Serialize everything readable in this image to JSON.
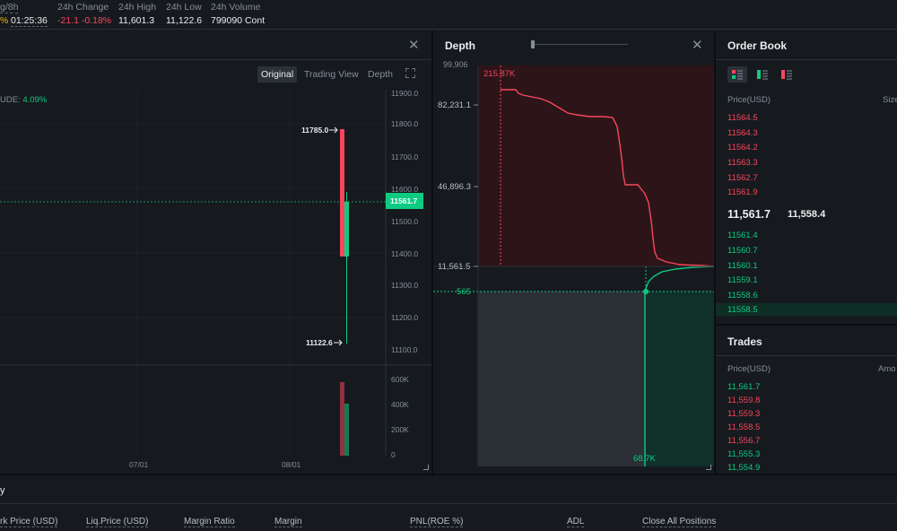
{
  "ticker": {
    "funding_label": "g/8h",
    "funding_pct": "%",
    "countdown": "01:25:36",
    "change_label": "24h Change",
    "change_value": "-21.1 -0.18%",
    "high_label": "24h High",
    "high_value": "11,601.3",
    "low_label": "24h Low",
    "low_value": "11,122.6",
    "volume_label": "24h Volume",
    "volume_value": "799090 Cont"
  },
  "chart": {
    "views": [
      "Original",
      "Trading View",
      "Depth"
    ],
    "active_view": "Original",
    "indicator": "UDE:",
    "indicator_value": "4.09%",
    "price_ticks": [
      "11900.0",
      "11800.0",
      "11700.0",
      "11600.0",
      "11500.0",
      "11400.0",
      "11300.0",
      "11200.0",
      "11100.0"
    ],
    "volume_ticks": [
      "600K",
      "400K",
      "200K",
      "0"
    ],
    "date_ticks": [
      "07/01",
      "08/01"
    ],
    "last_price_tag": "11561.7",
    "high_annotation": "11785.0",
    "low_annotation": "11122.6",
    "colors": {
      "up": "#0ecb81",
      "down": "#f6465d"
    }
  },
  "depth": {
    "title": "Depth",
    "y_ticks": [
      "82,231.1",
      "46,896.3",
      "11,561.5"
    ],
    "top_partial": "99,906",
    "ask_total": "215.87K",
    "bid_total": "68.7K",
    "bid_level": "565"
  },
  "order_book": {
    "title": "Order Book",
    "price_header": "Price(USD)",
    "size_header": "Size",
    "asks": [
      "11564.5",
      "11564.3",
      "11564.2",
      "11563.3",
      "11562.7",
      "11561.9"
    ],
    "last_price": "11,561.7",
    "mark_price": "11,558.4",
    "bids": [
      "11561.4",
      "11560.7",
      "11560.1",
      "11559.1",
      "11558.6",
      "11558.5"
    ]
  },
  "trades": {
    "title": "Trades",
    "price_header": "Price(USD)",
    "amount_header": "Amo",
    "rows": [
      {
        "price": "11,561.7",
        "side": "buy"
      },
      {
        "price": "11,559.8",
        "side": "sell"
      },
      {
        "price": "11,559.3",
        "side": "sell"
      },
      {
        "price": "11,558.5",
        "side": "sell"
      },
      {
        "price": "11,556.7",
        "side": "sell"
      },
      {
        "price": "11,555.3",
        "side": "buy"
      },
      {
        "price": "11,554.9",
        "side": "buy"
      }
    ]
  },
  "positions": {
    "tab_partial": "y",
    "columns": [
      "rk Price (USD)",
      "Liq.Price (USD)",
      "Margin Ratio",
      "Margin",
      "PNL(ROE %)",
      "ADL",
      "Close All Positions"
    ]
  }
}
